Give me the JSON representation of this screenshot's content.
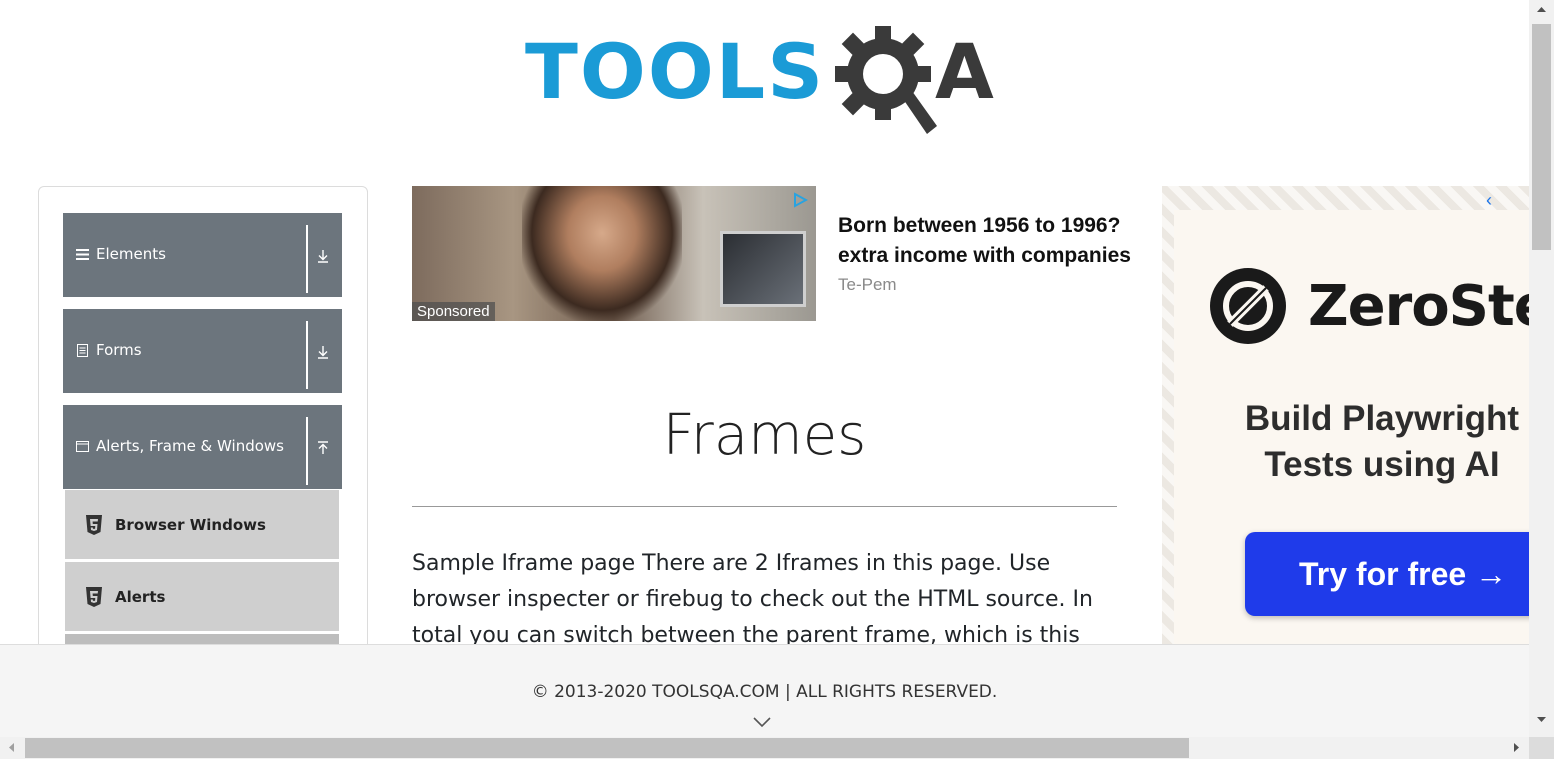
{
  "logo": {
    "part1": "TOOLS",
    "part2": "A",
    "colors": {
      "tools": "#1b9bd6",
      "qa": "#3a3a3a"
    }
  },
  "sidebar": {
    "groups": [
      {
        "label": "Elements",
        "icon": "hamburger-icon",
        "toggle": "expand-down-icon"
      },
      {
        "label": "Forms",
        "icon": "document-icon",
        "toggle": "expand-down-icon"
      },
      {
        "label": "Alerts, Frame & Windows",
        "icon": "window-icon",
        "toggle": "collapse-up-icon"
      }
    ],
    "items": [
      {
        "label": "Browser Windows",
        "icon": "html5-icon"
      },
      {
        "label": "Alerts",
        "icon": "html5-icon"
      }
    ],
    "colors": {
      "header": "#6c757d",
      "item": "#cfcfcf"
    }
  },
  "ad": {
    "sponsored": "Sponsored",
    "headline": "Born between 1956 to 1996? extra income with companies",
    "source": "Te-Pem"
  },
  "main": {
    "title": "Frames",
    "body": "Sample Iframe page There are 2 Iframes in this page. Use browser inspecter or firebug to check out the HTML source. In total you can switch between the parent frame, which is this window, and"
  },
  "right_ad": {
    "brand": "ZeroStep",
    "tagline_line1": "Build Playwright",
    "tagline_line2": "Tests using AI",
    "cta": "Try for free →",
    "cta_color": "#1f3bea"
  },
  "footer": {
    "copyright": "© 2013-2020 TOOLSQA.COM | ALL RIGHTS RESERVED."
  }
}
